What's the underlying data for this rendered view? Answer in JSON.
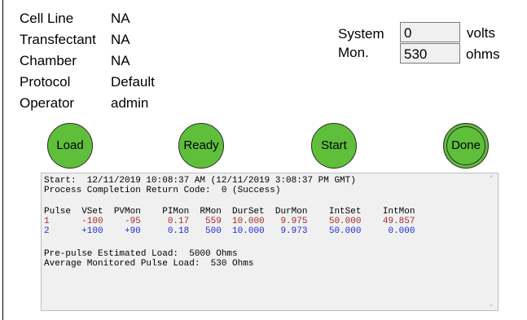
{
  "info": [
    {
      "label": "Cell Line",
      "value": "NA"
    },
    {
      "label": "Transfectant",
      "value": "NA"
    },
    {
      "label": "Chamber",
      "value": "NA"
    },
    {
      "label": "Protocol",
      "value": "Default"
    },
    {
      "label": "Operator",
      "value": "admin"
    }
  ],
  "system": {
    "label_line1": "System",
    "label_line2": "Mon.",
    "volts_value": "0",
    "volts_unit": "volts",
    "ohms_value": "530",
    "ohms_unit": "ohms"
  },
  "buttons": {
    "load": "Load",
    "ready": "Ready",
    "start": "Start",
    "done": "Done"
  },
  "colors": {
    "button_green": "#5fbf3b",
    "pulse1_color": "#a52a2a",
    "pulse2_color": "#1f2bd6"
  },
  "log": {
    "start_line": "Start:  12/11/2019 10:08:37 AM (12/11/2019 3:08:37 PM GMT)",
    "return_code_line": "Process Completion Return Code:  0 (Success)",
    "header": "Pulse  VSet  PVMon    PIMon  RMon  DurSet  DurMon    IntSet    IntMon",
    "pulse_rows": [
      "1      -100    -95     0.17   559  10.000   9.975    50.000    49.857",
      "2      +100    +90     0.18   500  10.000   9.973    50.000     0.000"
    ],
    "estimated_load_line": "Pre-pulse Estimated Load:  5000 Ohms",
    "monitored_load_line": "Average Monitored Pulse Load:  530 Ohms"
  },
  "scrollbar": {
    "up_icon": "chevron-up-icon",
    "down_icon": "chevron-down-icon"
  }
}
